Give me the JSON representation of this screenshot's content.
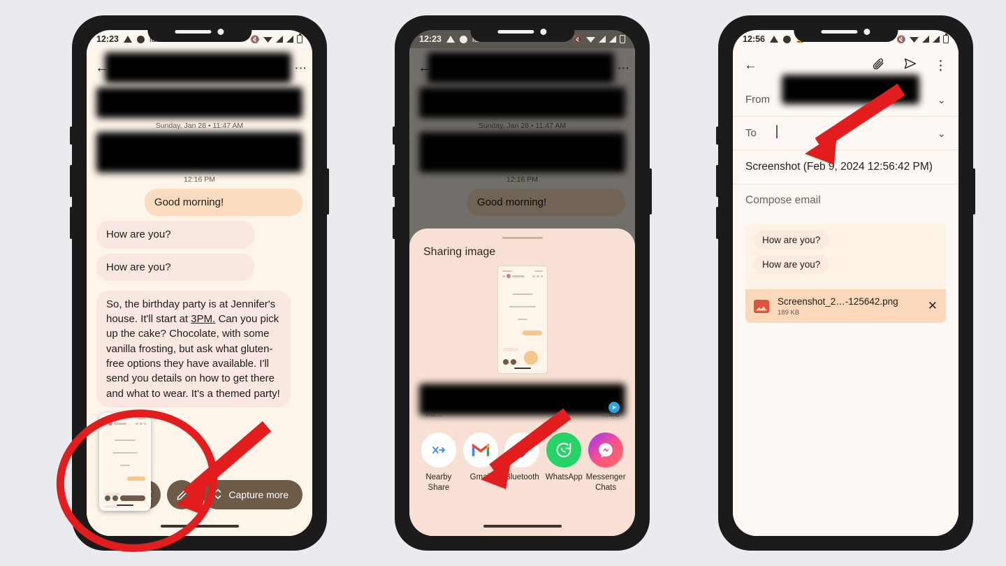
{
  "background_color": "#e9ebee",
  "accent_annotation_color": "#e31d1d",
  "phones": [
    {
      "id": "phone-1-messages-screenshot",
      "status_bar": {
        "time": "12:23",
        "left_icons": [
          "warning-triangle-icon",
          "circle-icon",
          "id-label",
          "dot-icon"
        ],
        "id_label": "id",
        "right_icons": [
          "mute-icon",
          "wifi-icon",
          "signal-icon",
          "signal-icon",
          "battery-icon"
        ]
      },
      "header": {
        "back_icon": "back-arrow-icon",
        "overflow_icon": "more-vertical-icon",
        "title_redacted": true
      },
      "date_separator": "Sunday, Jan 28 • 11:47 AM",
      "timestamp": "12:16 PM",
      "messages": [
        {
          "side": "out",
          "text": "Good morning!"
        },
        {
          "side": "in",
          "text": "How are you?"
        },
        {
          "side": "in",
          "text": "How are you?"
        },
        {
          "side": "in",
          "text": "So, the birthday party is at Jennifer's house. It'll start at 3PM. Can you pick up the cake? Chocolate, with some vanilla frosting, but ask what gluten-free options they have available. I'll send you details on how to get there and what to wear. It's a themed party!",
          "underline": "3PM."
        }
      ],
      "capture_toolbar": {
        "share_icon": "share-icon",
        "edit_icon": "pencil-icon",
        "capture_more_label": "Capture more",
        "capture_more_icon": "expand-vertical-icon"
      }
    },
    {
      "id": "phone-2-share-sheet",
      "status_bar": {
        "time": "12:23",
        "id_label": "id"
      },
      "date_separator": "Sunday, Jan 28 • 11:47 AM",
      "timestamp": "12:16 PM",
      "dimmed_message": "Good morning!",
      "sheet": {
        "title": "Sharing image",
        "contacts": [
          {
            "label": "Ro…",
            "badge_icon": "telegram-icon"
          },
          {
            "label": "…alie",
            "badge_icon": "telegram-icon"
          }
        ],
        "apps": [
          {
            "label": "Nearby Share",
            "icon": "nearby-share-icon"
          },
          {
            "label": "Gmail",
            "icon": "gmail-icon"
          },
          {
            "label": "Bluetooth",
            "icon": "bluetooth-icon"
          },
          {
            "label": "WhatsApp",
            "icon": "whatsapp-icon"
          },
          {
            "label": "Messenger Chats",
            "icon": "messenger-icon"
          }
        ]
      }
    },
    {
      "id": "phone-3-gmail-compose",
      "status_bar": {
        "time": "12:56",
        "left_icons": [
          "warning-triangle-icon",
          "circle-icon",
          "bell-icon",
          "dot-icon"
        ],
        "right_icons": [
          "mute-icon",
          "wifi-icon",
          "signal-icon",
          "signal-icon",
          "battery-icon"
        ]
      },
      "toolbar": {
        "back_icon": "back-arrow-icon",
        "attach_icon": "paperclip-icon",
        "send_icon": "send-icon",
        "overflow_icon": "more-vertical-icon"
      },
      "fields": [
        {
          "label": "From",
          "value": "",
          "redacted": true,
          "caret_icon": "chevron-down-icon"
        },
        {
          "label": "To",
          "value": "",
          "caret_icon": "chevron-down-icon",
          "cursor": true
        }
      ],
      "subject": "Screenshot (Feb 9, 2024 12:56:42 PM)",
      "body_placeholder": "Compose email",
      "quoted_bubbles": [
        "How are you?",
        "How are you?"
      ],
      "attachment": {
        "name": "Screenshot_2…-125642.png",
        "size": "189 KB",
        "remove_icon": "close-icon",
        "type_icon": "image-file-icon"
      }
    }
  ]
}
